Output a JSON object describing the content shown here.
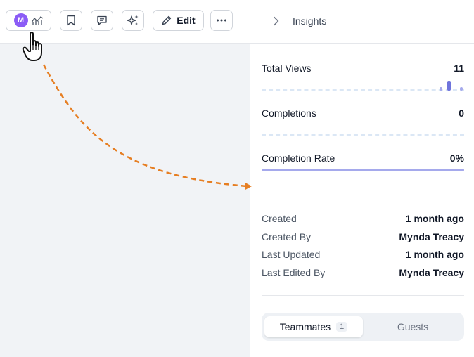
{
  "toolbar": {
    "avatar_initial": "M",
    "edit_label": "Edit"
  },
  "panel": {
    "title": "Insights"
  },
  "metrics": {
    "total_views_label": "Total Views",
    "total_views_value": "11",
    "completions_label": "Completions",
    "completions_value": "0",
    "completion_rate_label": "Completion Rate",
    "completion_rate_value": "0%"
  },
  "meta": {
    "created_label": "Created",
    "created_value": "1 month ago",
    "created_by_label": "Created By",
    "created_by_value": "Mynda Treacy",
    "last_updated_label": "Last Updated",
    "last_updated_value": "1 month ago",
    "last_edited_by_label": "Last Edited By",
    "last_edited_by_value": "Mynda Treacy"
  },
  "tabs": {
    "teammates_label": "Teammates",
    "teammates_count": "1",
    "guests_label": "Guests"
  },
  "colors": {
    "avatar": "#8b5cf6",
    "accent": "#a5a9ec",
    "arrow": "#e67e22"
  },
  "icons": [
    "analytics-icon",
    "bookmark-icon",
    "comment-icon",
    "sparkle-icon",
    "pencil-icon",
    "more-icon",
    "chevron-right-icon",
    "hand-cursor-icon"
  ]
}
